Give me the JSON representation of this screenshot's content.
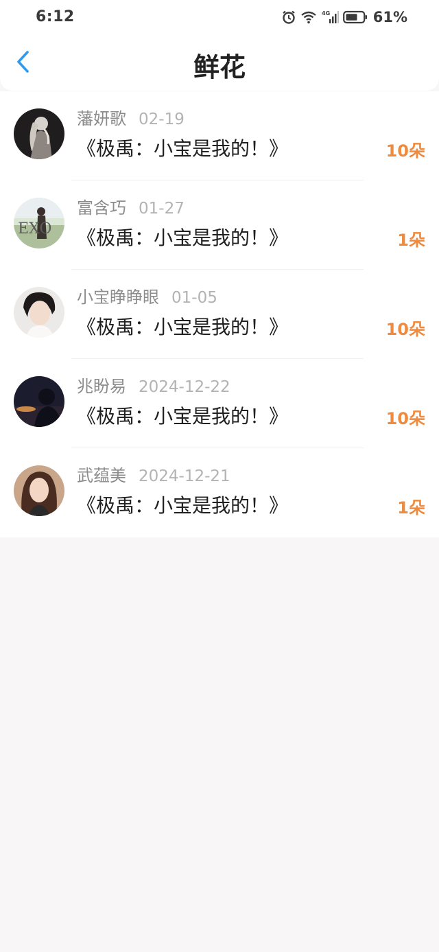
{
  "status_bar": {
    "time": "6:12",
    "battery_percent": "61%",
    "icons": [
      "alarm-icon",
      "wifi-icon",
      "signal-4g-icon",
      "battery-icon"
    ]
  },
  "header": {
    "title": "鲜花",
    "back_icon": "chevron-left-icon"
  },
  "colors": {
    "accent_back": "#2f9bf0",
    "amount": "#f08a3c",
    "background": "#f8f6f7"
  },
  "records": [
    {
      "name": "藩妍歌",
      "date": "02-19",
      "book": "《极禹：小宝是我的！》",
      "amount": "10朵"
    },
    {
      "name": "富含巧",
      "date": "01-27",
      "book": "《极禹：小宝是我的！》",
      "amount": "1朵"
    },
    {
      "name": "小宝睁睁眼",
      "date": "01-05",
      "book": "《极禹：小宝是我的！》",
      "amount": "10朵"
    },
    {
      "name": "兆盼易",
      "date": "2024-12-22",
      "book": "《极禹：小宝是我的！》",
      "amount": "10朵"
    },
    {
      "name": "武蕴美",
      "date": "2024-12-21",
      "book": "《极禹：小宝是我的！》",
      "amount": "1朵"
    }
  ]
}
